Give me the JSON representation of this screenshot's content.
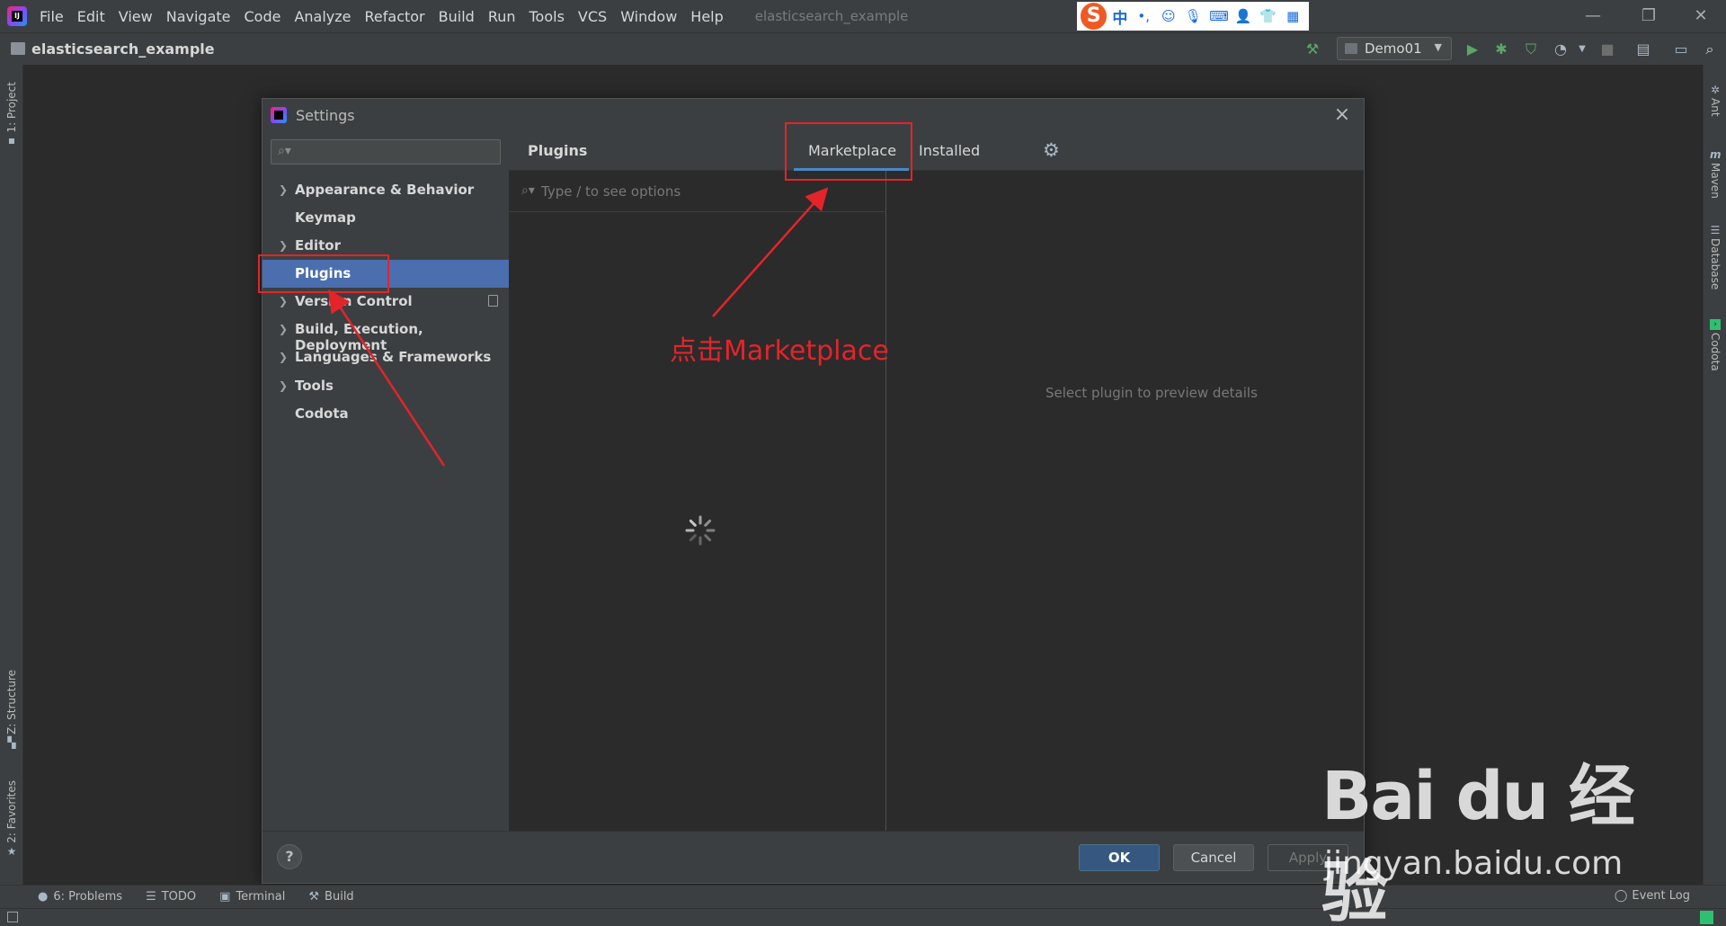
{
  "menubar": {
    "items": [
      "File",
      "Edit",
      "View",
      "Navigate",
      "Code",
      "Analyze",
      "Refactor",
      "Build",
      "Run",
      "Tools",
      "VCS",
      "Window",
      "Help"
    ],
    "project_title": "elasticsearch_example",
    "ime": {
      "lang": "中",
      "punct": "•,",
      "icons": [
        "emoji-icon",
        "mic-icon",
        "keyboard-icon",
        "user-icon",
        "shirt-icon",
        "grid-icon"
      ]
    }
  },
  "toolbar": {
    "project_name": "elasticsearch_example",
    "run_config": "Demo01"
  },
  "left_strip": {
    "project": "1: Project",
    "structure": "Z: Structure",
    "favorites": "2: Favorites"
  },
  "right_strip": {
    "ant": "Ant",
    "maven": "Maven",
    "database": "Database",
    "codota": "Codota"
  },
  "bottom_tabs": {
    "problems": "6: Problems",
    "todo": "TODO",
    "terminal": "Terminal",
    "build": "Build",
    "event_log": "Event Log"
  },
  "dialog": {
    "title": "Settings",
    "nav": [
      {
        "label": "Appearance & Behavior",
        "expandable": true
      },
      {
        "label": "Keymap",
        "expandable": false
      },
      {
        "label": "Editor",
        "expandable": true
      },
      {
        "label": "Plugins",
        "expandable": false,
        "selected": true
      },
      {
        "label": "Version Control",
        "expandable": true
      },
      {
        "label": "Build, Execution, Deployment",
        "expandable": true
      },
      {
        "label": "Languages & Frameworks",
        "expandable": true
      },
      {
        "label": "Tools",
        "expandable": true
      },
      {
        "label": "Codota",
        "expandable": false
      }
    ],
    "content_title": "Plugins",
    "tabs": {
      "marketplace": "Marketplace",
      "installed": "Installed"
    },
    "search_placeholder": "Type / to see options",
    "preview_text": "Select plugin to preview details",
    "buttons": {
      "help": "?",
      "ok": "OK",
      "cancel": "Cancel",
      "apply": "Apply"
    }
  },
  "annotation": {
    "text": "点击Marketplace",
    "color": "#e3242b"
  },
  "watermark": {
    "logo": "Bai du 经验",
    "url": "jingyan.baidu.com"
  },
  "colors": {
    "accent": "#4b6eaf",
    "tab_underline": "#4a88c7",
    "ok_button": "#365880",
    "bg": "#2b2b2b",
    "panel": "#3c3f41"
  }
}
